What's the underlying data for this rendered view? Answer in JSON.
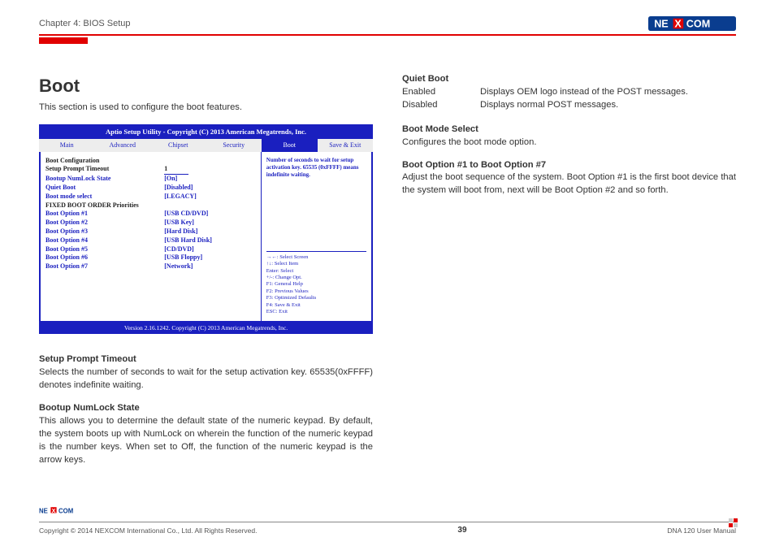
{
  "header": {
    "chapter": "Chapter 4: BIOS Setup",
    "logo_text": "NEXCOM"
  },
  "left": {
    "title": "Boot",
    "intro": "This section is used to configure the boot features.",
    "bios": {
      "title": "Aptio Setup Utility - Copyright (C) 2013 American Megatrends, Inc.",
      "tabs": [
        "Main",
        "Advanced",
        "Chipset",
        "Security",
        "Boot",
        "Save & Exit"
      ],
      "active_tab": "Boot",
      "rows_top": [
        {
          "lbl": "Boot Configuration",
          "val": "",
          "cls": "black"
        },
        {
          "lbl": "Setup Prompt Timeout",
          "val": "1",
          "cls": "black",
          "val_underline": true
        },
        {
          "lbl": "Bootup NumLock State",
          "val": "[On]",
          "cls": "blue"
        },
        {
          "lbl": "",
          "val": ""
        },
        {
          "lbl": "Quiet Boot",
          "val": "[Disabled]",
          "cls": "blue"
        },
        {
          "lbl": "",
          "val": ""
        },
        {
          "lbl": "Boot mode select",
          "val": "[LEGACY]",
          "cls": "blue"
        },
        {
          "lbl": "",
          "val": ""
        },
        {
          "lbl": "FIXED BOOT ORDER Priorities",
          "val": "",
          "cls": "black"
        },
        {
          "lbl": "Boot Option #1",
          "val": "[USB CD/DVD]",
          "cls": "blue"
        },
        {
          "lbl": "Boot Option #2",
          "val": "[USB Key]",
          "cls": "blue"
        },
        {
          "lbl": "Boot Option #3",
          "val": "[Hard Disk]",
          "cls": "blue"
        },
        {
          "lbl": "Boot Option #4",
          "val": "[USB Hard Disk]",
          "cls": "blue"
        },
        {
          "lbl": "Boot Option #5",
          "val": "[CD/DVD]",
          "cls": "blue"
        },
        {
          "lbl": "Boot Option #6",
          "val": "[USB Floppy]",
          "cls": "blue"
        },
        {
          "lbl": "Boot Option #7",
          "val": "[Network]",
          "cls": "blue"
        }
      ],
      "help_text": "Number of seconds to wait for setup activation key. 65535 (0xFFFF) means indefinite waiting.",
      "key_help": [
        "→←: Select Screen",
        "↑↓: Select Item",
        "Enter: Select",
        "+/-: Change Opt.",
        "F1: General Help",
        "F2: Previous Values",
        "F3: Optimized Defaults",
        "F4: Save & Exit",
        "ESC: Exit"
      ],
      "footer": "Version 2.16.1242. Copyright (C) 2013 American Megatrends, Inc."
    },
    "s1_title": "Setup Prompt Timeout",
    "s1_body": "Selects the number of seconds to wait for the setup activation key. 65535(0xFFFF) denotes indefinite waiting.",
    "s2_title": "Bootup NumLock State",
    "s2_body": "This allows you to determine the default state of the numeric keypad. By default, the system boots up with NumLock on wherein the function of the numeric keypad is the number keys. When set to Off, the function of the numeric keypad is the arrow keys."
  },
  "right": {
    "s1_title": "Quiet Boot",
    "s1_rows": [
      {
        "k": "Enabled",
        "v": "Displays OEM logo instead of the POST messages."
      },
      {
        "k": "Disabled",
        "v": "Displays normal POST messages."
      }
    ],
    "s2_title": "Boot Mode Select",
    "s2_body": "Configures the boot mode option.",
    "s3_title": "Boot Option #1 to Boot Option #7",
    "s3_body": "Adjust the boot sequence of the system. Boot Option #1 is the first boot device that the system will boot from, next will be Boot Option #2 and so forth."
  },
  "footer": {
    "copyright": "Copyright © 2014 NEXCOM International Co., Ltd. All Rights Reserved.",
    "page": "39",
    "manual": "DNA 120 User Manual"
  }
}
